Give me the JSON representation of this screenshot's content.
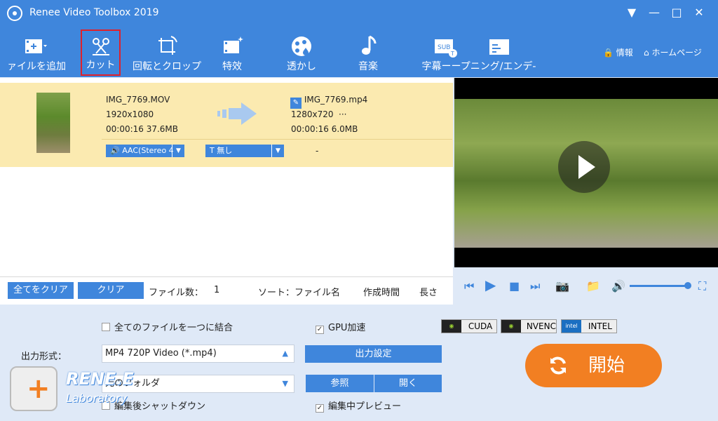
{
  "window": {
    "title": "Renee Video Toolbox 2019",
    "buttons": [
      "▼",
      "—",
      "□",
      "✕"
    ]
  },
  "toolbar": {
    "items": [
      {
        "label": "ァイルを追加",
        "icon": "add-file-icon"
      },
      {
        "label": "カット",
        "icon": "cut-icon"
      },
      {
        "label": "回転とクロップ",
        "icon": "crop-rotate-icon"
      },
      {
        "label": "特效",
        "icon": "effects-icon"
      },
      {
        "label": "透かし",
        "icon": "watermark-icon"
      },
      {
        "label": "音楽",
        "icon": "music-icon"
      },
      {
        "label": "字幕ーープニング/エンデ‐",
        "icon": "subtitle-icon"
      }
    ],
    "info_label": "情報",
    "home_label": "ホームページ"
  },
  "file": {
    "source_name": "IMG_7769.MOV",
    "source_res": "1920x1080",
    "source_meta": "00:00:16  37.6MB",
    "output_name": "IMG_7769.mp4",
    "output_res": "1280x720",
    "output_more": "···",
    "output_meta": "00:00:16  6.0MB",
    "audio_combo": "AAC(Stereo 4",
    "subtitle_combo": "無し",
    "dash": "-"
  },
  "listbar": {
    "clear_all": "全てをクリア",
    "clear": "クリア",
    "file_count_label": "ファイル数：",
    "file_count": "1",
    "sort_label": "ソート：ファイル名",
    "sort_created": "作成時間",
    "sort_length": "長さ"
  },
  "options": {
    "merge_label": "全てのファイルを一つに結合",
    "gpu_label": "GPU加速",
    "shutdown_label": "編集後シャットダウン",
    "preview_label": "編集中プレビュー",
    "gpu_badges": [
      "CUDA",
      "NVENC",
      "INTEL"
    ]
  },
  "output": {
    "format_label": "出力形式：",
    "format_value": "MP4 720P Video (*.mp4)",
    "settings_button": "出力設定",
    "folder_value": "元のフォルダ",
    "browse_button": "参照",
    "open_button": "開く"
  },
  "start_button": "開始",
  "brand": {
    "name": "RENE.E",
    "sub": "Laboratory"
  },
  "colors": {
    "accent": "#3f86dc",
    "start": "#f27f22",
    "row_highlight": "#fbeab0"
  }
}
